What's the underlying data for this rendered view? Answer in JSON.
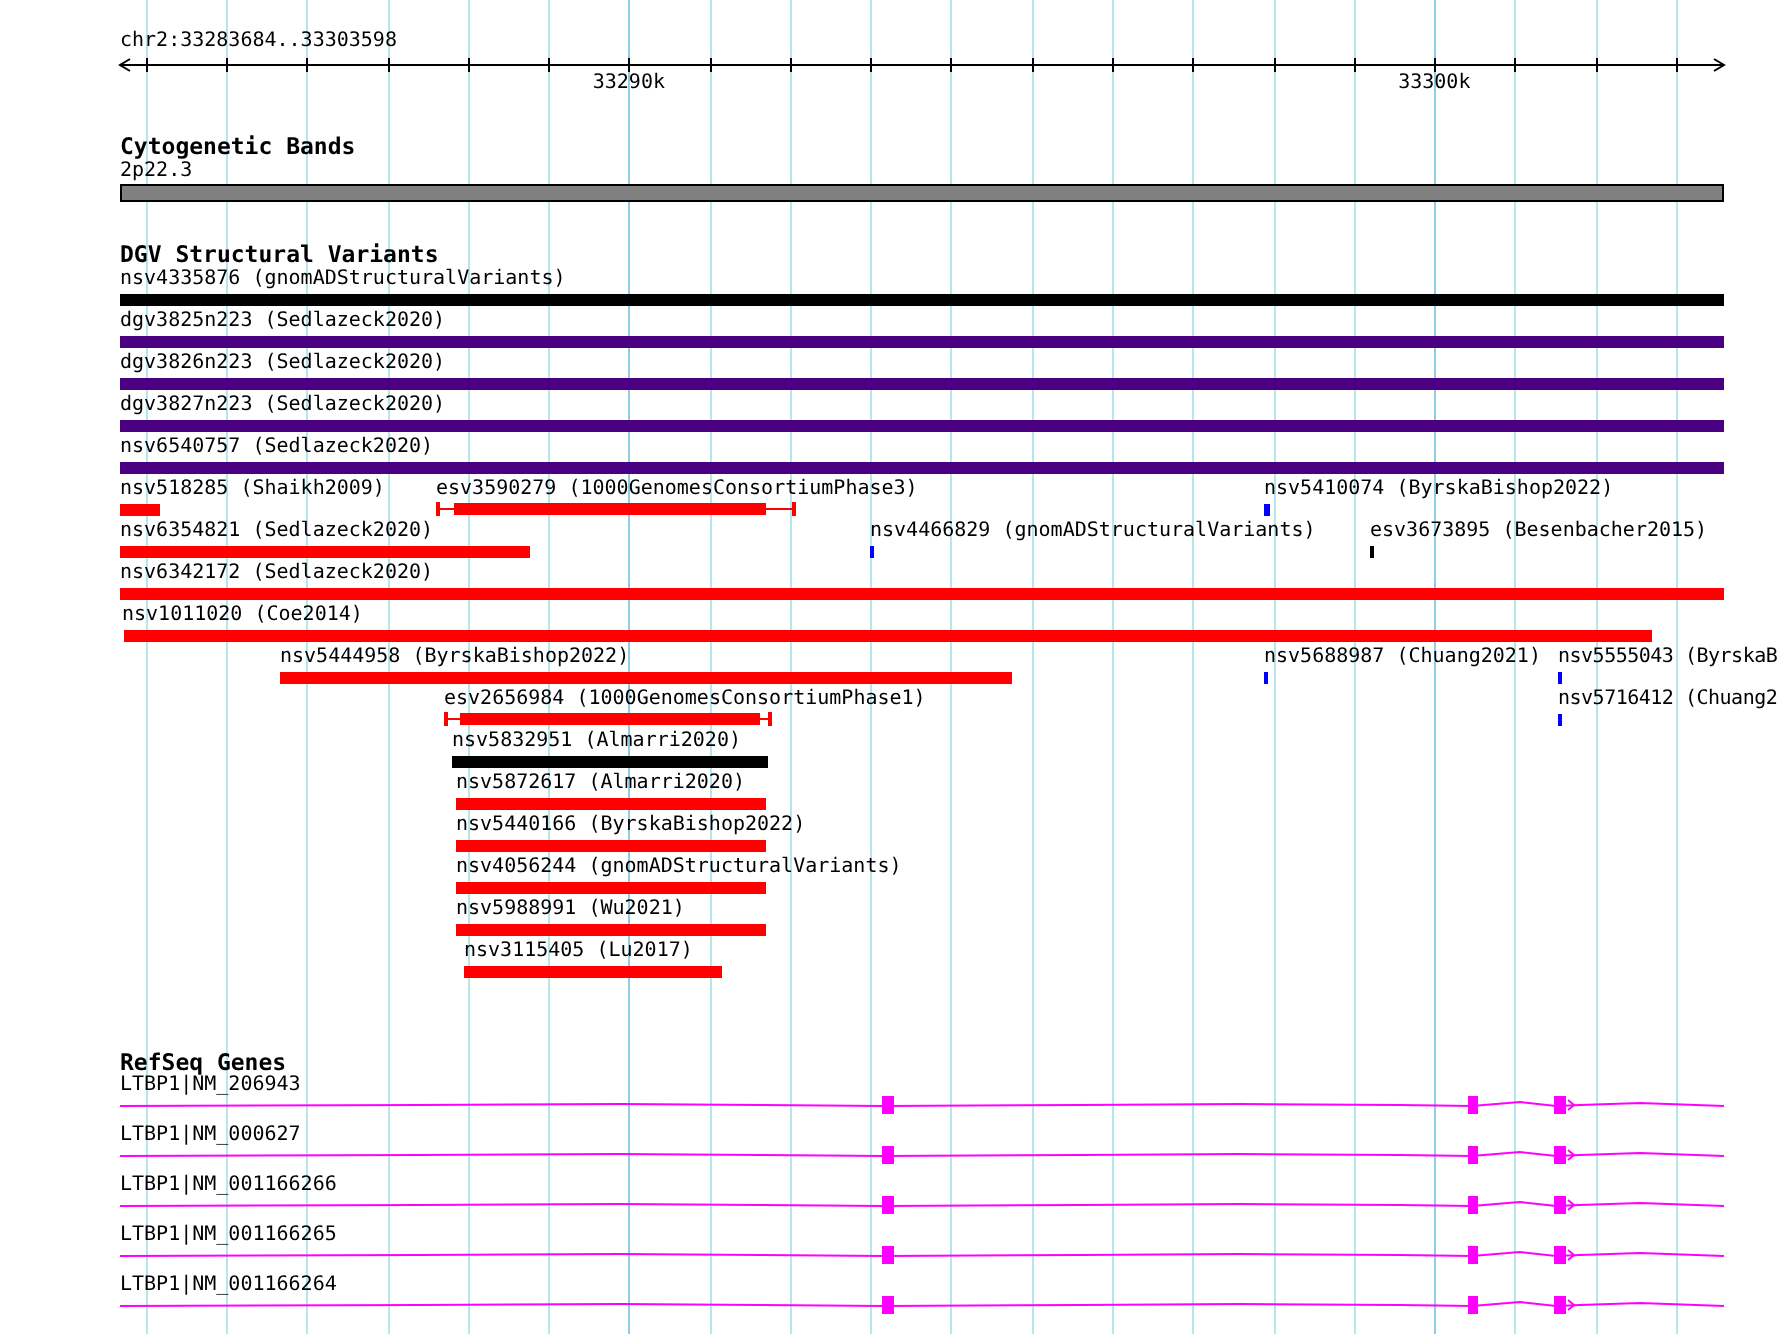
{
  "location": "chr2:33283684..33303598",
  "scale": {
    "ticks": [
      {
        "label": "33290k"
      },
      {
        "label": "33300k"
      }
    ]
  },
  "cytoband_track": {
    "title": "Cytogenetic Bands",
    "band": {
      "label": "2p22.3",
      "color": "#808080"
    }
  },
  "variant_track": {
    "title": "DGV Structural Variants",
    "features": [
      {
        "label": "nsv4335876 (gnomADStructuralVariants)",
        "color": "#000000",
        "kind": "bar"
      },
      {
        "label": "dgv3825n223 (Sedlazeck2020)",
        "color": "#4b0082",
        "kind": "bar"
      },
      {
        "label": "dgv3826n223 (Sedlazeck2020)",
        "color": "#4b0082",
        "kind": "bar"
      },
      {
        "label": "dgv3827n223 (Sedlazeck2020)",
        "color": "#4b0082",
        "kind": "bar"
      },
      {
        "label": "nsv6540757 (Sedlazeck2020)",
        "color": "#4b0082",
        "kind": "bar"
      },
      {
        "label": "nsv518285 (Shaikh2009)",
        "color": "#ff0000",
        "kind": "bar"
      },
      {
        "label": "esv3590279 (1000GenomesConsortiumPhase3)",
        "color": "#ff0000",
        "kind": "interval"
      },
      {
        "label": "nsv5410074 (ByrskaBishop2022)",
        "color": "#0000ff",
        "kind": "bar"
      },
      {
        "label": "nsv6354821 (Sedlazeck2020)",
        "color": "#ff0000",
        "kind": "bar"
      },
      {
        "label": "nsv4466829 (gnomADStructuralVariants)",
        "color": "#0000ff",
        "kind": "bar"
      },
      {
        "label": "esv3673895 (Besenbacher2015)",
        "color": "#000000",
        "kind": "bar"
      },
      {
        "label": "nsv6342172 (Sedlazeck2020)",
        "color": "#ff0000",
        "kind": "bar"
      },
      {
        "label": "nsv1011020 (Coe2014)",
        "color": "#ff0000",
        "kind": "bar"
      },
      {
        "label": "nsv5444958 (ByrskaBishop2022)",
        "color": "#ff0000",
        "kind": "bar"
      },
      {
        "label": "nsv5688987 (Chuang2021)",
        "color": "#0000ff",
        "kind": "bar"
      },
      {
        "label": "nsv5555043 (ByrskaB",
        "color": "#0000ff",
        "kind": "bar"
      },
      {
        "label": "esv2656984 (1000GenomesConsortiumPhase1)",
        "color": "#ff0000",
        "kind": "interval"
      },
      {
        "label": "nsv5716412 (Chuang2",
        "color": "#0000ff",
        "kind": "bar"
      },
      {
        "label": "nsv5832951 (Almarri2020)",
        "color": "#000000",
        "kind": "bar"
      },
      {
        "label": "nsv5872617 (Almarri2020)",
        "color": "#ff0000",
        "kind": "bar"
      },
      {
        "label": "nsv5440166 (ByrskaBishop2022)",
        "color": "#ff0000",
        "kind": "bar"
      },
      {
        "label": "nsv4056244 (gnomADStructuralVariants)",
        "color": "#ff0000",
        "kind": "bar"
      },
      {
        "label": "nsv5988991 (Wu2021)",
        "color": "#ff0000",
        "kind": "bar"
      },
      {
        "label": "nsv3115405 (Lu2017)",
        "color": "#ff0000",
        "kind": "bar"
      }
    ]
  },
  "gene_track": {
    "title": "RefSeq Genes",
    "transcripts": [
      {
        "label": "LTBP1|NM_206943"
      },
      {
        "label": "LTBP1|NM_000627"
      },
      {
        "label": "LTBP1|NM_001166266"
      },
      {
        "label": "LTBP1|NM_001166265"
      },
      {
        "label": "LTBP1|NM_001166264"
      }
    ]
  }
}
